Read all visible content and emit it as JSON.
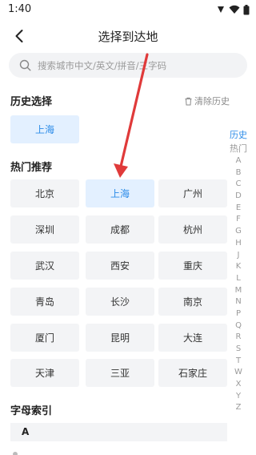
{
  "status": {
    "time": "1:40"
  },
  "header": {
    "title": "选择到达地"
  },
  "search": {
    "placeholder": "搜索城市中文/英文/拼音/三字码"
  },
  "history": {
    "title": "历史选择",
    "clear_label": "清除历史",
    "items": [
      {
        "label": "上海",
        "selected": true
      }
    ]
  },
  "hot": {
    "title": "热门推荐",
    "cities": [
      {
        "label": "北京",
        "selected": false
      },
      {
        "label": "上海",
        "selected": true
      },
      {
        "label": "广州",
        "selected": false
      },
      {
        "label": "深圳",
        "selected": false
      },
      {
        "label": "成都",
        "selected": false
      },
      {
        "label": "杭州",
        "selected": false
      },
      {
        "label": "武汉",
        "selected": false
      },
      {
        "label": "西安",
        "selected": false
      },
      {
        "label": "重庆",
        "selected": false
      },
      {
        "label": "青岛",
        "selected": false
      },
      {
        "label": "长沙",
        "selected": false
      },
      {
        "label": "南京",
        "selected": false
      },
      {
        "label": "厦门",
        "selected": false
      },
      {
        "label": "昆明",
        "selected": false
      },
      {
        "label": "大连",
        "selected": false
      },
      {
        "label": "天津",
        "selected": false
      },
      {
        "label": "三亚",
        "selected": false
      },
      {
        "label": "石家庄",
        "selected": false
      }
    ]
  },
  "letters": {
    "title": "字母索引",
    "first": "A"
  },
  "index_bar": {
    "items": [
      "历史",
      "热门",
      "A",
      "B",
      "C",
      "D",
      "E",
      "F",
      "G",
      "H",
      "J",
      "K",
      "L",
      "M",
      "N",
      "P",
      "Q",
      "R",
      "S",
      "T",
      "W",
      "X",
      "Y",
      "Z"
    ],
    "active": "历史"
  },
  "colors": {
    "accent": "#2b8be8",
    "chip_bg": "#f3f4f6",
    "chip_selected_bg": "#e3f0ff",
    "annotation_arrow": "#e03a3a"
  }
}
